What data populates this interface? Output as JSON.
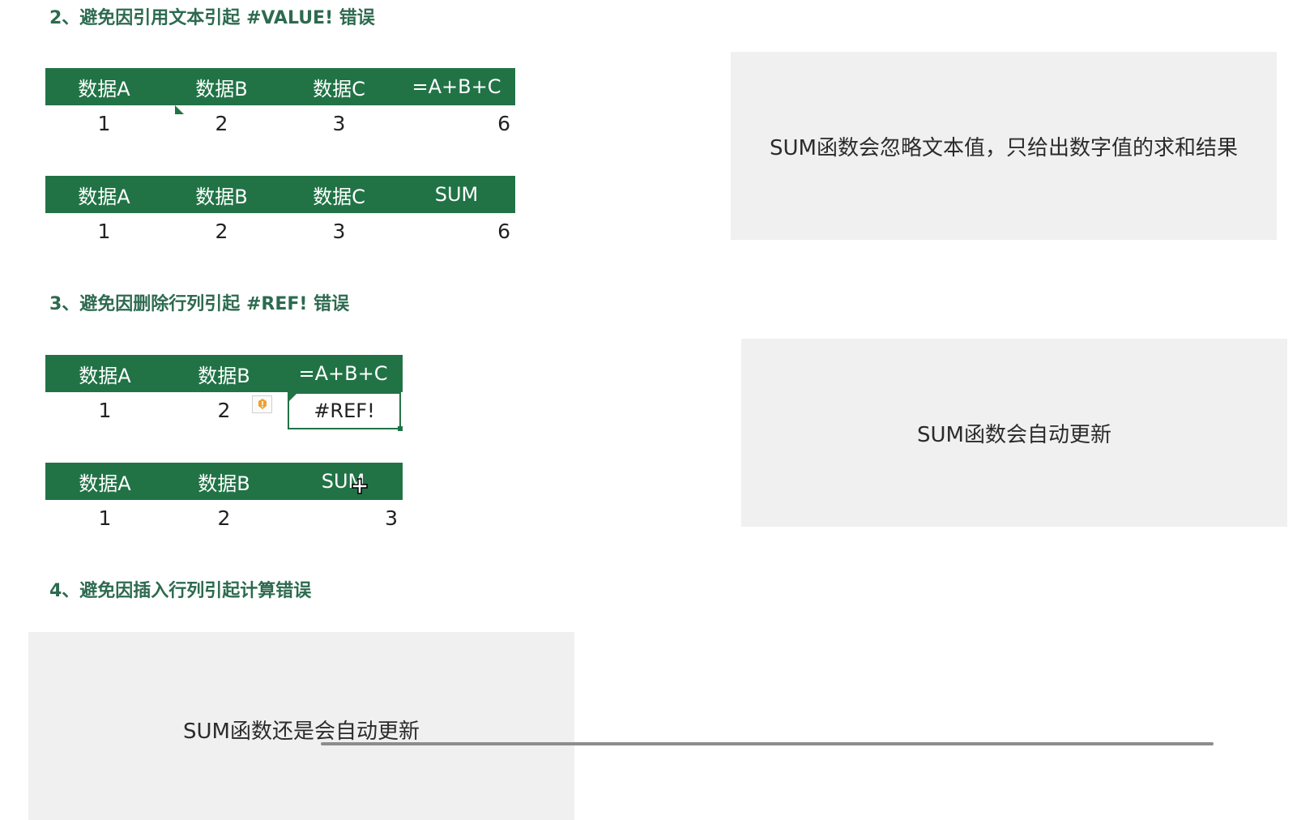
{
  "section2": {
    "heading": "2、避免因引用文本引起 #VALUE! 错误",
    "table1": {
      "headers": [
        "数据A",
        "数据B",
        "数据C",
        "=A+B+C"
      ],
      "values": [
        "1",
        "2",
        "3",
        "6"
      ]
    },
    "table2": {
      "headers": [
        "数据A",
        "数据B",
        "数据C",
        "SUM"
      ],
      "values": [
        "1",
        "2",
        "3",
        "6"
      ]
    },
    "note": "SUM函数会忽略文本值，只给出数字值的求和结果"
  },
  "section3": {
    "heading": "3、避免因删除行列引起 #REF! 错误",
    "table1": {
      "headers": [
        "数据A",
        "数据B",
        "=A+B+C"
      ],
      "values": [
        "1",
        "2",
        "#REF!"
      ]
    },
    "table2": {
      "headers": [
        "数据A",
        "数据B",
        "SUM"
      ],
      "values": [
        "1",
        "2",
        "3"
      ]
    },
    "note": "SUM函数会自动更新"
  },
  "section4": {
    "heading": "4、避免因插入行列引起计算错误",
    "note": "SUM函数还是会自动更新"
  },
  "colors": {
    "header_green": "#217346",
    "heading_green": "#2d6a4f",
    "note_bg": "#f0f0f0",
    "warning_orange": "#f0a030"
  },
  "icons": [
    "error-warning-icon",
    "move-cursor-icon"
  ]
}
